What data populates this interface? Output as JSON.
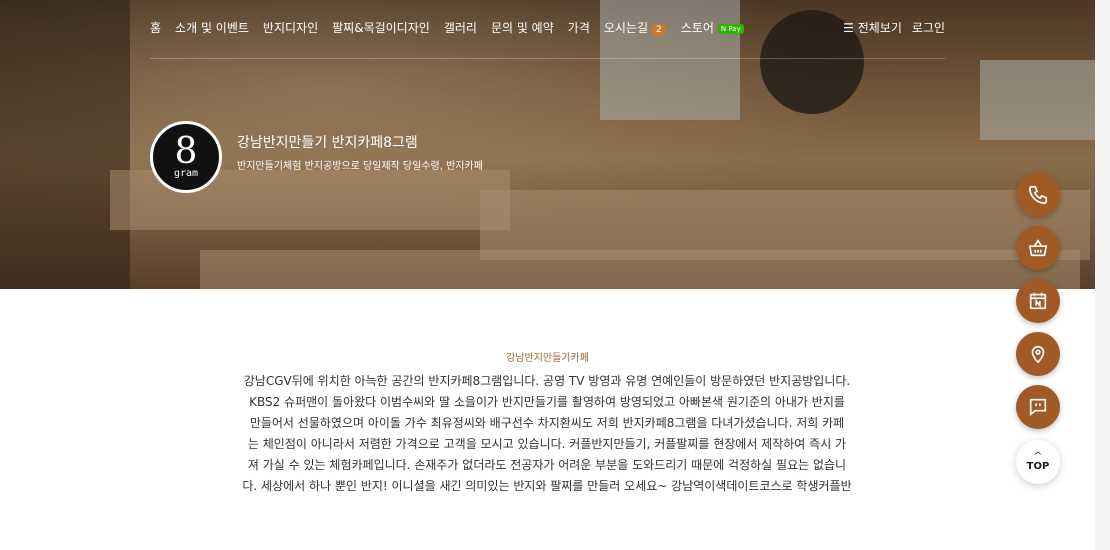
{
  "nav": {
    "items": [
      "홈",
      "소개 및 이벤트",
      "반지디자인",
      "팔찌&목걸이디자인",
      "갤러리",
      "문의 및 예약",
      "가격"
    ],
    "directions": {
      "label": "오시는길",
      "badge": "2"
    },
    "store": {
      "label": "스토어",
      "tag": "N Pay"
    },
    "menu_all": "☰ 전체보기",
    "login": "로그인"
  },
  "brand": {
    "logo_mark": "8",
    "logo_text": "gram",
    "title": "강남반지만들기 반지카페8그램",
    "subtitle": "반지만들기체험 반지공방으로 당일제작 당일수령, 반지카페"
  },
  "section": {
    "label": "강남반지만들기카페",
    "lines": [
      "강남CGV뒤에 위치한 아늑한 공간의 반지카페8그램입니다. 공영 TV 방영과 유명 연예인들이 방문하였던 반지공방입니다.",
      "KBS2 슈퍼맨이 돌아왔다 이범수씨와 딸 소을이가 반지만들기를 촬영하여 방영되었고 아빠본색 원기준의 아내가 반지를",
      "만들어서 선물하였으며 아이돌 가수 최유정씨와 배구선수 차지환씨도 저희 반지카페8그램을 다녀가셨습니다. 저희 카페",
      "는 체인점이 아니라서 저렴한 가격으로 고객을 모시고 있습니다. 커플반지만들기, 커플팔찌를 현장에서 제작하여 즉시 가",
      "져 가실 수 있는 체험카페입니다. 손재주가 없더라도 전공자가 어려운 부분을 도와드리기 때문에 걱정하실 필요는 없습니",
      "다. 세상에서 하나 뿐인 반지! 이니셜을 새긴 의미있는 반지와 팔찌를 만들러 오세요~ 강남역이색데이트코스로 학생커플반"
    ]
  },
  "fabs": [
    "phone-icon",
    "basket-icon",
    "calendar-icon",
    "location-icon",
    "chat-icon"
  ],
  "top_button": {
    "arrow": "^",
    "label": "TOP"
  },
  "colors": {
    "accent": "#a05a25",
    "label": "#a0642a",
    "badge": "#c47a2b",
    "npay": "#2db400"
  }
}
